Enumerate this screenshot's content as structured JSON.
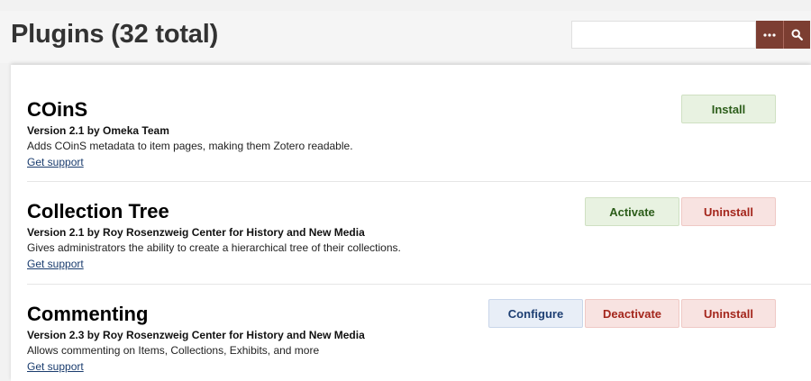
{
  "header": {
    "title": "Plugins (32 total)",
    "search": {
      "placeholder": "",
      "value": ""
    },
    "options_icon": "ellipsis-icon",
    "search_icon": "search-icon",
    "accent_color": "#7c3e32"
  },
  "plugins": [
    {
      "name": "COinS",
      "version": "Version 2.1 by Omeka Team",
      "description": "Adds COinS metadata to item pages, making them Zotero readable.",
      "support": "Get support",
      "actions": [
        "Install"
      ]
    },
    {
      "name": "Collection Tree",
      "version": "Version 2.1 by Roy Rosenzweig Center for History and New Media",
      "description": "Gives administrators the ability to create a hierarchical tree of their collections.",
      "support": "Get support",
      "actions": [
        "Activate",
        "Uninstall"
      ]
    },
    {
      "name": "Commenting",
      "version": "Version 2.3 by Roy Rosenzweig Center for History and New Media",
      "description": "Allows commenting on Items, Collections, Exhibits, and more",
      "support": "Get support",
      "actions": [
        "Configure",
        "Deactivate",
        "Uninstall"
      ]
    }
  ]
}
